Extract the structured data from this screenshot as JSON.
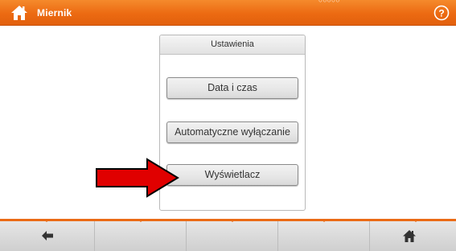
{
  "header": {
    "title": "Miernik",
    "status_dots": "○○○○○",
    "home_icon": "home-icon",
    "help_icon": "help-icon"
  },
  "panel": {
    "title": "Ustawienia",
    "items": [
      {
        "label": "Data i czas"
      },
      {
        "label": "Automatyczne wyłączanie"
      },
      {
        "label": "Wyświetlacz"
      }
    ]
  },
  "annotation": {
    "type": "arrow",
    "color": "#e00000",
    "points_to": "Wyświetlacz"
  },
  "footer": {
    "left_icon": "back-arrow-icon",
    "right_icon": "home-icon"
  },
  "colors": {
    "accent": "#ec6a12",
    "button_bg": "#e6e6e6",
    "footer_bg": "#d9d9d9"
  }
}
